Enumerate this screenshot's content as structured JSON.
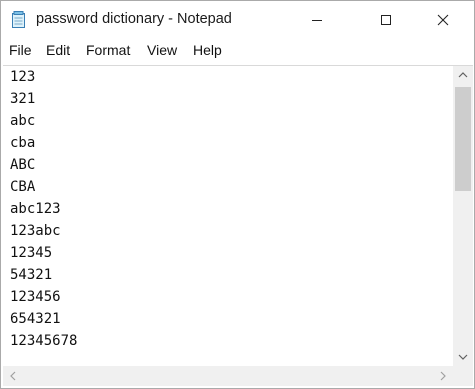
{
  "window": {
    "title": "password dictionary - Notepad",
    "icon": "notepad-icon"
  },
  "controls": {
    "minimize_icon": "minimize-icon",
    "maximize_icon": "maximize-icon",
    "close_icon": "close-icon"
  },
  "menu": {
    "items": [
      "File",
      "Edit",
      "Format",
      "View",
      "Help"
    ]
  },
  "editor": {
    "lines": [
      "123",
      "321",
      "abc",
      "cba",
      "ABC",
      "CBA",
      "abc123",
      "123abc",
      "12345",
      "54321",
      "123456",
      "654321",
      "12345678"
    ]
  },
  "scrollbar": {
    "vertical_position": 0.0,
    "up_icon": "chevron-up-icon",
    "down_icon": "chevron-down-icon",
    "left_icon": "chevron-left-icon",
    "right_icon": "chevron-right-icon"
  },
  "colors": {
    "window_border": "#aaaaaa",
    "scroll_track": "#f0f0f0",
    "scroll_thumb": "#cdcdcd"
  }
}
